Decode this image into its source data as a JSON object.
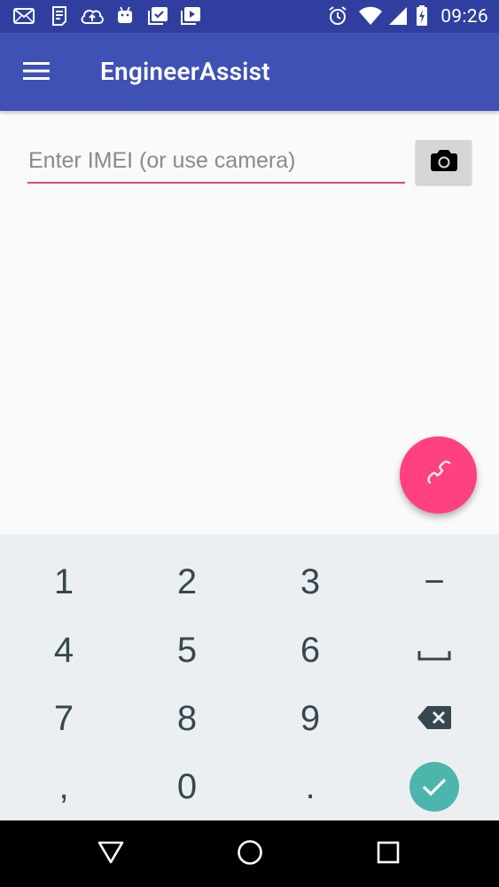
{
  "status_bar": {
    "time": "09:26",
    "left_icons": [
      "mail-icon",
      "clipboard-icon",
      "cloud-upload-icon",
      "android-icon",
      "checkbox-stack-icon",
      "play-stack-icon"
    ],
    "right_icons": [
      "alarm-icon",
      "wifi-icon",
      "signal-icon",
      "battery-charging-icon"
    ]
  },
  "app_bar": {
    "title": "EngineerAssist",
    "menu_icon": "hamburger-menu-icon"
  },
  "imei": {
    "placeholder": "Enter IMEI (or use camera)",
    "value": "",
    "camera_icon": "camera-icon",
    "underline_color": "#e84677"
  },
  "fab": {
    "icon": "phone-icon",
    "color": "#ff4081"
  },
  "keyboard": {
    "rows": [
      [
        "1",
        "2",
        "3",
        "−"
      ],
      [
        "4",
        "5",
        "6",
        "space"
      ],
      [
        "7",
        "8",
        "9",
        "backspace"
      ],
      [
        ",",
        "0",
        ".",
        "done"
      ]
    ],
    "done_color": "#4db6ac"
  },
  "nav_bar": {
    "buttons": [
      "back-icon",
      "home-icon",
      "recents-icon"
    ]
  },
  "colors": {
    "status_bar": "#303f9f",
    "app_bar": "#3f51b5",
    "keyboard_bg": "#eceff1",
    "key_text": "#37474f"
  }
}
